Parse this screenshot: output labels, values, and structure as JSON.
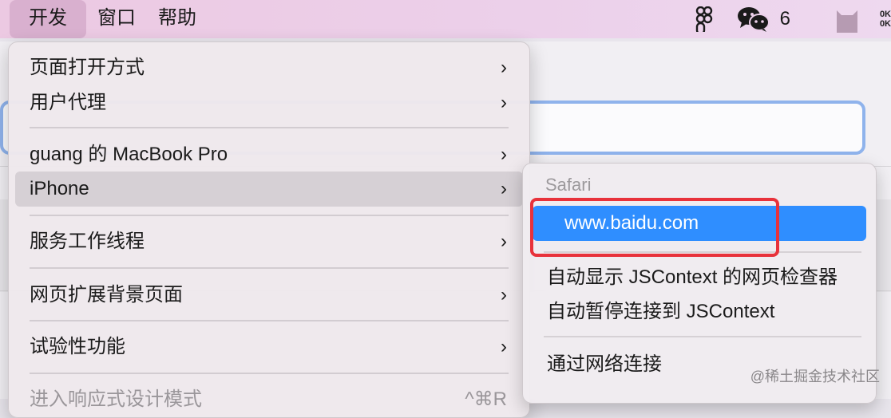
{
  "menubar": {
    "items": [
      "开发",
      "窗口",
      "帮助"
    ],
    "wechat_count": "6",
    "status_line1": "0K",
    "status_line2": "0K"
  },
  "develop_menu": {
    "items": [
      {
        "label": "页面打开方式",
        "submenu": true
      },
      {
        "label": "用户代理",
        "submenu": true
      },
      {
        "label": "guang 的 MacBook Pro",
        "submenu": true
      },
      {
        "label": "iPhone",
        "submenu": true,
        "highlighted": true
      },
      {
        "label": "服务工作线程",
        "submenu": true
      },
      {
        "label": "网页扩展背景页面",
        "submenu": true
      },
      {
        "label": "试验性功能",
        "submenu": true
      },
      {
        "label": "进入响应式设计模式",
        "shortcut": "^⌘R"
      }
    ],
    "chevron": "›"
  },
  "iphone_submenu": {
    "section_header": "Safari",
    "items": [
      {
        "label": "www.baidu.com",
        "selected": true
      },
      {
        "label": "自动显示 JSContext 的网页检查器"
      },
      {
        "label": "自动暂停连接到 JSContext"
      },
      {
        "label": "通过网络连接"
      }
    ]
  },
  "watermark": "@稀土掘金技术社区",
  "colors": {
    "accent": "#2f8eff",
    "annotation": "#e8323b",
    "menubar": "#ecc9e2"
  }
}
